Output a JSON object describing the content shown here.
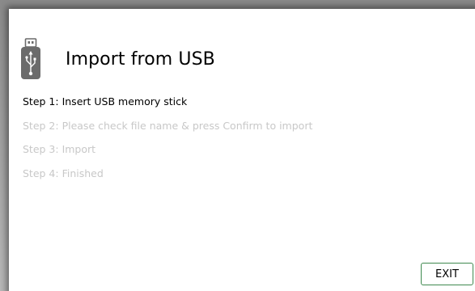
{
  "header": {
    "icon": "usb-drive-icon",
    "title": "Import from USB"
  },
  "steps": [
    {
      "label": "Step 1: Insert USB memory stick",
      "state": "active"
    },
    {
      "label": "Step 2: Please check file name & press Confirm to import",
      "state": "inactive"
    },
    {
      "label": "Step 3: Import",
      "state": "inactive"
    },
    {
      "label": "Step 4: Finished",
      "state": "inactive"
    }
  ],
  "footer": {
    "exit_label": "EXIT"
  },
  "colors": {
    "active_text": "#000000",
    "inactive_text": "#c8c8c8",
    "exit_border": "#3f8a4f",
    "icon": "#6b6b6b"
  }
}
